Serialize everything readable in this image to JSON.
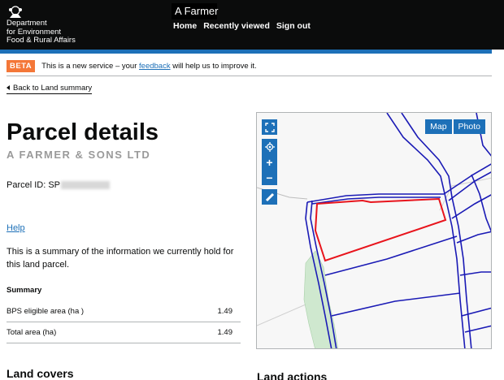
{
  "header": {
    "dept_lines": [
      "Department",
      "for Environment",
      "Food & Rural Affairs"
    ],
    "user": "A Farmer",
    "nav": [
      "Home",
      "Recently viewed",
      "Sign out"
    ]
  },
  "beta": {
    "tag": "BETA",
    "text_before": "This is a new service – your ",
    "link": "feedback",
    "text_after": " will help us to improve it."
  },
  "back_link": "Back to Land summary",
  "title": "Parcel details",
  "farm_name": "A FARMER & SONS LTD",
  "parcel_id_label": "Parcel ID: SP",
  "help_link": "Help",
  "summary_intro": "This is a summary of the information we currently hold for this land parcel.",
  "summary": {
    "heading": "Summary",
    "rows": [
      {
        "label": "BPS eligible area (ha )",
        "value": "1.49"
      },
      {
        "label": "Total area (ha)",
        "value": "1.49"
      }
    ]
  },
  "land_covers_heading": "Land covers",
  "land_actions_heading": "Land actions",
  "map": {
    "buttons": [
      "Map",
      "Photo"
    ],
    "icons": [
      "fullscreen-icon",
      "locate-icon",
      "zoom-in-icon",
      "zoom-out-icon",
      "measure-icon"
    ],
    "boundary_color": "#1a1ab5",
    "selected_color": "#e8141c",
    "woodland_color": "#cfe8cf"
  }
}
